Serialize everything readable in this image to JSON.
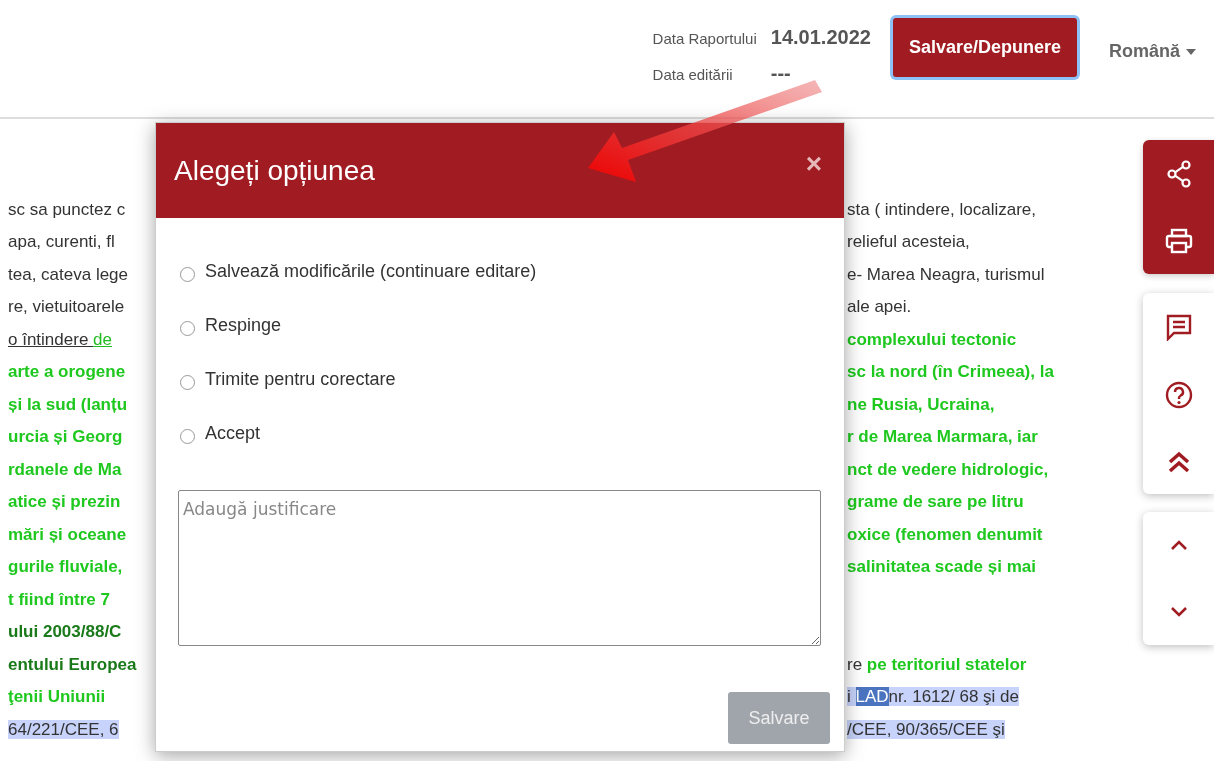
{
  "header": {
    "report_date_label": "Data Raportului",
    "report_date": "14.01.2022",
    "edit_date_label": "Data editării",
    "edit_date": "---",
    "save_button": "Salvare/Depunere",
    "language": "Română"
  },
  "document_lines": [
    {
      "left": [
        {
          "text": "sc sa punctez c",
          "kind": "plain"
        }
      ],
      "right": [
        {
          "text": "sta ( intindere, localizare,",
          "kind": "plain"
        }
      ]
    },
    {
      "left": [
        {
          "text": "apa, curenti, fl",
          "kind": "plain"
        }
      ],
      "right": [
        {
          "text": "relieful acesteia,",
          "kind": "plain"
        }
      ]
    },
    {
      "left": [
        {
          "text": "tea, cateva lege",
          "kind": "plain"
        }
      ],
      "right": [
        {
          "text": "e- Marea Neagra, turismul",
          "kind": "plain"
        }
      ]
    },
    {
      "left": [
        {
          "text": "re, vietuitoarele",
          "kind": "plain"
        }
      ],
      "right": [
        {
          "text": "ale apei.",
          "kind": "plain"
        }
      ]
    },
    {
      "left": [
        {
          "text": " o întindere ",
          "kind": "underline"
        },
        {
          "text": "de",
          "kind": "link"
        }
      ],
      "right": [
        {
          "text": "complexului tectonic",
          "kind": "green"
        }
      ]
    },
    {
      "left": [
        {
          "text": "arte a orogene",
          "kind": "green"
        }
      ],
      "right": [
        {
          "text": "sc la nord (în Crimeea), la",
          "kind": "green"
        }
      ]
    },
    {
      "left": [
        {
          "text": "și la sud (lanțu",
          "kind": "green"
        }
      ],
      "right": [
        {
          "text": "ne Rusia, Ucraina,",
          "kind": "green"
        }
      ]
    },
    {
      "left": [
        {
          "text": "urcia și Georg",
          "kind": "green"
        }
      ],
      "right": [
        {
          "text": "r de Marea Marmara, iar",
          "kind": "green"
        }
      ]
    },
    {
      "left": [
        {
          "text": "rdanele de Ma",
          "kind": "green"
        }
      ],
      "right": [
        {
          "text": "nct de vedere hidrologic,",
          "kind": "green"
        }
      ]
    },
    {
      "left": [
        {
          "text": "atice și prezin",
          "kind": "green"
        }
      ],
      "right": [
        {
          "text": "grame de sare pe litru",
          "kind": "green"
        }
      ]
    },
    {
      "left": [
        {
          "text": "mări și oceane",
          "kind": "green"
        }
      ],
      "right": [
        {
          "text": "oxice (fenomen denumit",
          "kind": "green"
        }
      ]
    },
    {
      "left": [
        {
          "text": "gurile fluviale,",
          "kind": "green"
        }
      ],
      "right": [
        {
          "text": "salinitatea scade și mai",
          "kind": "green"
        }
      ]
    },
    {
      "left": [
        {
          "text": "t fiind între 7",
          "kind": "green"
        }
      ]
    },
    {
      "left": [
        {
          "text": "ului 2003/88/C",
          "kind": "darkgreen"
        }
      ]
    },
    {
      "left": [
        {
          "text": "entului Europea",
          "kind": "darkgreen"
        }
      ],
      "right": [
        {
          "text": "re ",
          "kind": "plain"
        },
        {
          "text": "pe teritoriul statelor",
          "kind": "green"
        }
      ]
    },
    {
      "left": [
        {
          "text": "ţenii    Uniunii",
          "kind": "green"
        }
      ],
      "right": [
        {
          "text": "i ",
          "kind": "highlight"
        },
        {
          "text": "LAD",
          "kind": "selected"
        },
        {
          "text": "nr. 1612/     68 şi de",
          "kind": "highlight"
        }
      ]
    },
    {
      "left": [
        {
          "text": "64/221/CEE, 6",
          "kind": "highlight"
        }
      ],
      "right": [
        {
          "text": "/CEE, 90/365/CEE şi",
          "kind": "highlight"
        }
      ]
    }
  ],
  "modal": {
    "title": "Alegeți opțiunea",
    "close": "×",
    "options": [
      {
        "label": "Salvează modificările (continuare editare)",
        "selected": false
      },
      {
        "label": "Respinge",
        "selected": false
      },
      {
        "label": "Trimite pentru corectare",
        "selected": false
      },
      {
        "label": "Accept",
        "selected": false
      }
    ],
    "justification": {
      "placeholder": "Adaugă justificare"
    },
    "save_button": {
      "label": "Salvare",
      "disabled": true
    }
  }
}
